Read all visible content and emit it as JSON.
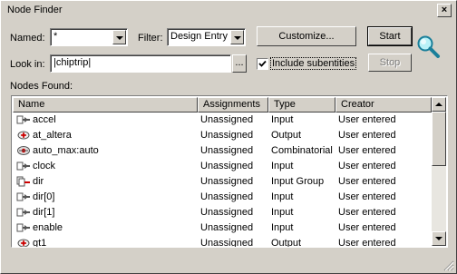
{
  "window": {
    "title": "Node Finder",
    "close_label": "×"
  },
  "named": {
    "label": "Named:",
    "value": "*"
  },
  "filter": {
    "label": "Filter:",
    "value": "Design Entry ("
  },
  "customize_label": "Customize...",
  "start_label": "Start",
  "stop_label": "Stop",
  "look_in": {
    "label": "Look in:",
    "value": "|chiptrip|",
    "browse_label": "..."
  },
  "include_subentities": {
    "label": "Include subentities",
    "checked": true
  },
  "nodes_found_label": "Nodes Found:",
  "table": {
    "columns": [
      "Name",
      "Assignments",
      "Type",
      "Creator"
    ],
    "rows": [
      {
        "icon": "input-pin-icon",
        "name": "accel",
        "assignments": "Unassigned",
        "type": "Input",
        "creator": "User entered"
      },
      {
        "icon": "output-pin-icon",
        "name": "at_altera",
        "assignments": "Unassigned",
        "type": "Output",
        "creator": "User entered"
      },
      {
        "icon": "combinatorial-node-icon",
        "name": "auto_max:auto",
        "assignments": "Unassigned",
        "type": "Combinatorial",
        "creator": "User entered"
      },
      {
        "icon": "input-pin-icon",
        "name": "clock",
        "assignments": "Unassigned",
        "type": "Input",
        "creator": "User entered"
      },
      {
        "icon": "input-group-icon",
        "name": "dir",
        "assignments": "Unassigned",
        "type": "Input Group",
        "creator": "User entered"
      },
      {
        "icon": "input-pin-icon",
        "name": "dir[0]",
        "assignments": "Unassigned",
        "type": "Input",
        "creator": "User entered"
      },
      {
        "icon": "input-pin-icon",
        "name": "dir[1]",
        "assignments": "Unassigned",
        "type": "Input",
        "creator": "User entered"
      },
      {
        "icon": "input-pin-icon",
        "name": "enable",
        "assignments": "Unassigned",
        "type": "Input",
        "creator": "User entered"
      },
      {
        "icon": "output-pin-icon",
        "name": "gt1",
        "assignments": "Unassigned",
        "type": "Output",
        "creator": "User entered"
      }
    ]
  },
  "icons": {
    "search": "magnifier-icon",
    "dropdown": "chevron-down-icon",
    "checkbox": "checkmark-icon"
  },
  "colors": {
    "dialog": "#d4d0c8",
    "list_bg": "#ffffff",
    "magnifier_lens": "#5fd0e0",
    "magnifier_handle": "#1a7f9a"
  }
}
